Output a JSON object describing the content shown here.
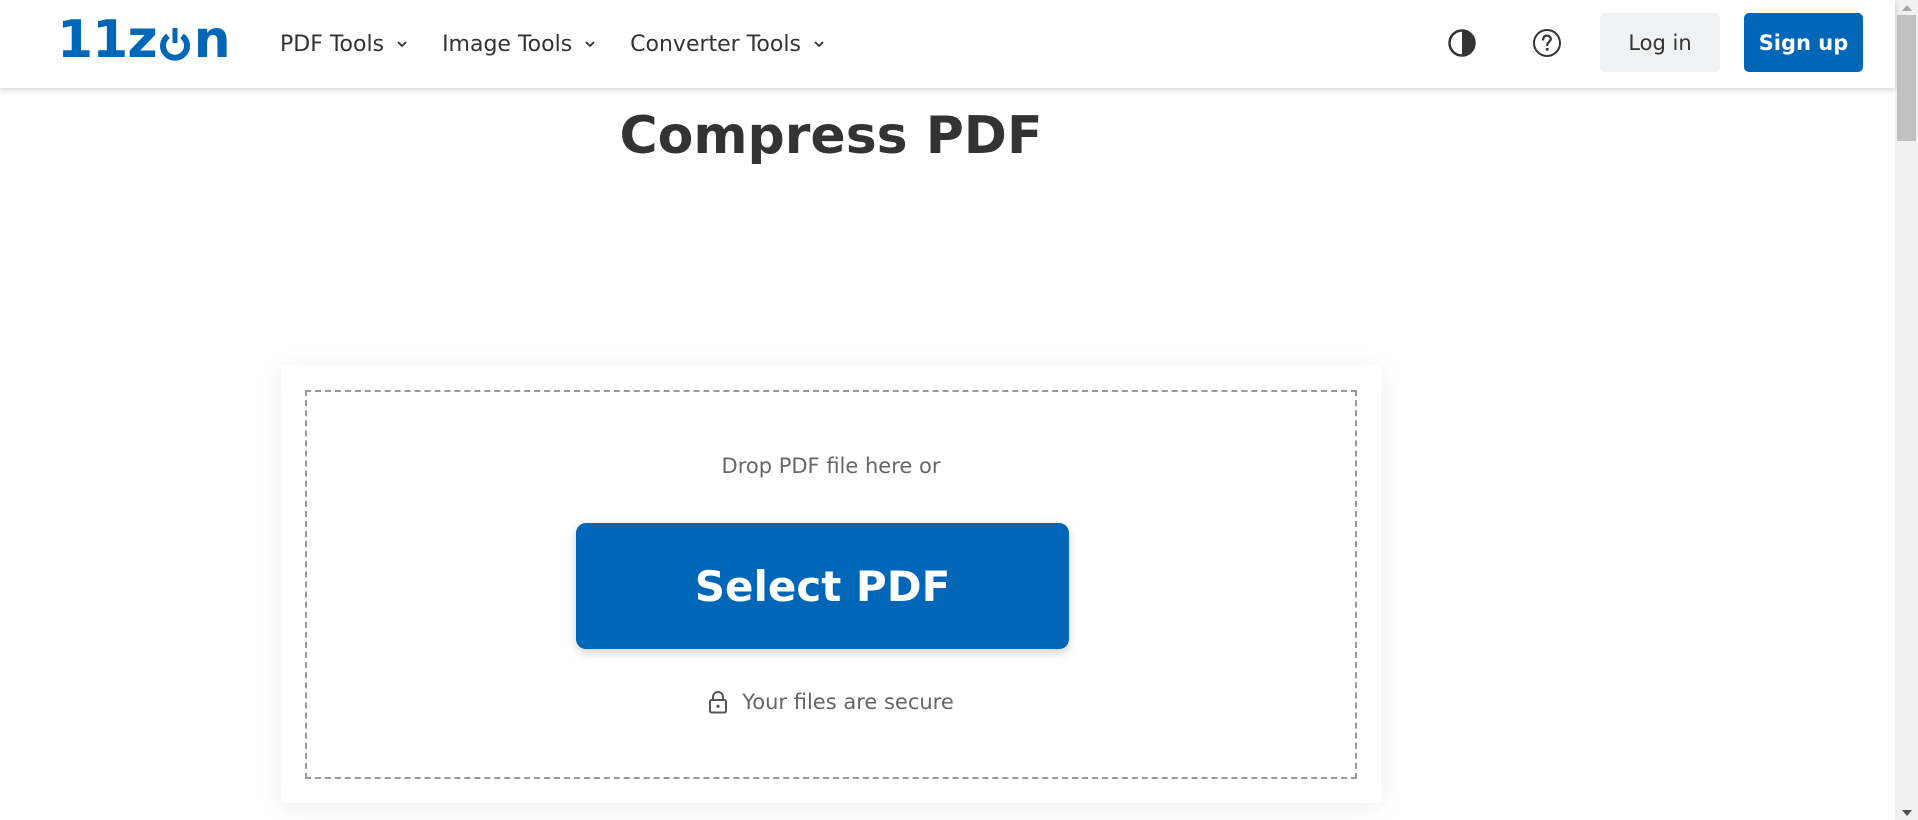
{
  "brand": {
    "logo_prefix": "11z",
    "logo_suffix": "n",
    "color": "#0067b8"
  },
  "nav": {
    "items": [
      {
        "label": "PDF Tools",
        "icon": "chevron-down-icon"
      },
      {
        "label": "Image Tools",
        "icon": "chevron-down-icon"
      },
      {
        "label": "Converter Tools",
        "icon": "chevron-down-icon"
      }
    ]
  },
  "header_actions": {
    "theme_toggle_icon": "contrast-icon",
    "help_icon": "help-circle-icon",
    "login_label": "Log in",
    "signup_label": "Sign up"
  },
  "main": {
    "title": "Compress PDF",
    "dropzone": {
      "drop_text": "Drop PDF file here or",
      "select_button_label": "Select PDF",
      "secure_icon": "lock-icon",
      "secure_text": "Your files are secure"
    }
  },
  "colors": {
    "primary": "#0067b8",
    "text": "#333333",
    "muted_text": "#666666",
    "login_bg": "#f1f2f3"
  }
}
